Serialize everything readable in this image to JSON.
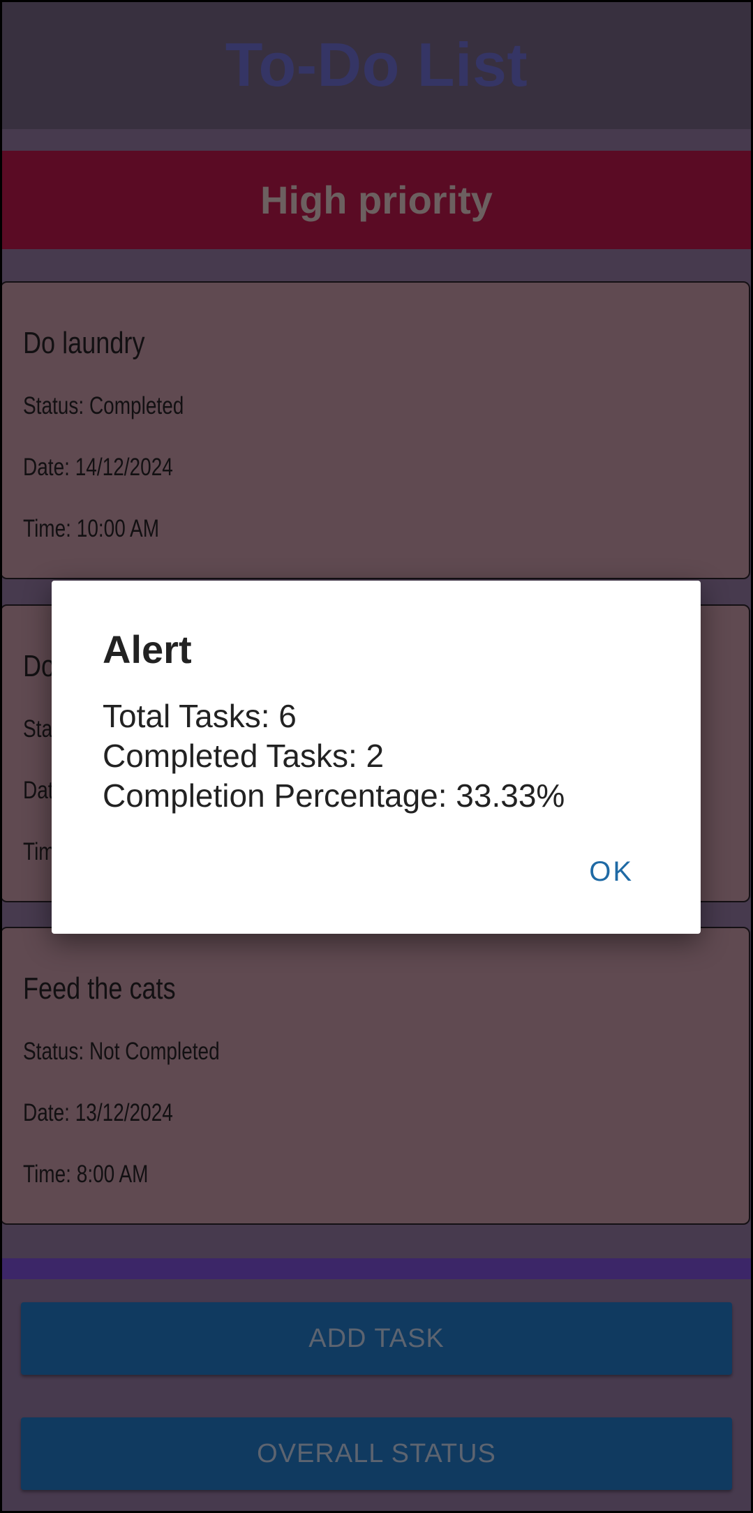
{
  "app": {
    "title": "To-Do List"
  },
  "priority_section": {
    "label": "High priority"
  },
  "tasks": [
    {
      "title": "Do laundry",
      "status": "Status: Completed",
      "date": "Date: 14/12/2024",
      "time": "Time: 10:00 AM"
    },
    {
      "title": "Do",
      "status": "Sta",
      "date": "Dat",
      "time": "Tim"
    },
    {
      "title": "Feed the cats",
      "status": "Status: Not Completed",
      "date": "Date: 13/12/2024",
      "time": "Time: 8:00 AM"
    }
  ],
  "actions": {
    "add_task": "ADD TASK",
    "overall_status": "OVERALL STATUS"
  },
  "dialog": {
    "title": "Alert",
    "lines": [
      "Total Tasks: 6",
      "Completed Tasks: 2",
      "Completion Percentage: 33.33%"
    ],
    "ok_label": "OK"
  },
  "colors": {
    "header_bg": "#38303f",
    "priority_banner": "#5a0b24",
    "card_bg": "#604a51",
    "button_bg": "#103a60",
    "dialog_accent": "#1f6aa5"
  }
}
